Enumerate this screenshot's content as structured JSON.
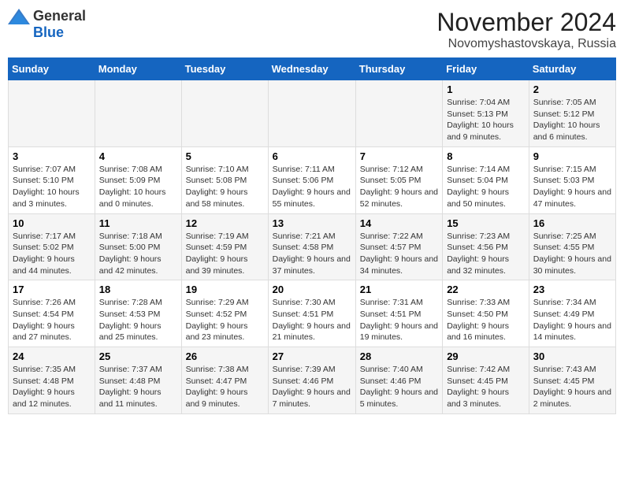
{
  "header": {
    "logo_general": "General",
    "logo_blue": "Blue",
    "month_year": "November 2024",
    "location": "Novomyshastovskaya, Russia"
  },
  "days_of_week": [
    "Sunday",
    "Monday",
    "Tuesday",
    "Wednesday",
    "Thursday",
    "Friday",
    "Saturday"
  ],
  "weeks": [
    [
      {
        "day": "",
        "info": ""
      },
      {
        "day": "",
        "info": ""
      },
      {
        "day": "",
        "info": ""
      },
      {
        "day": "",
        "info": ""
      },
      {
        "day": "",
        "info": ""
      },
      {
        "day": "1",
        "info": "Sunrise: 7:04 AM\nSunset: 5:13 PM\nDaylight: 10 hours and 9 minutes."
      },
      {
        "day": "2",
        "info": "Sunrise: 7:05 AM\nSunset: 5:12 PM\nDaylight: 10 hours and 6 minutes."
      }
    ],
    [
      {
        "day": "3",
        "info": "Sunrise: 7:07 AM\nSunset: 5:10 PM\nDaylight: 10 hours and 3 minutes."
      },
      {
        "day": "4",
        "info": "Sunrise: 7:08 AM\nSunset: 5:09 PM\nDaylight: 10 hours and 0 minutes."
      },
      {
        "day": "5",
        "info": "Sunrise: 7:10 AM\nSunset: 5:08 PM\nDaylight: 9 hours and 58 minutes."
      },
      {
        "day": "6",
        "info": "Sunrise: 7:11 AM\nSunset: 5:06 PM\nDaylight: 9 hours and 55 minutes."
      },
      {
        "day": "7",
        "info": "Sunrise: 7:12 AM\nSunset: 5:05 PM\nDaylight: 9 hours and 52 minutes."
      },
      {
        "day": "8",
        "info": "Sunrise: 7:14 AM\nSunset: 5:04 PM\nDaylight: 9 hours and 50 minutes."
      },
      {
        "day": "9",
        "info": "Sunrise: 7:15 AM\nSunset: 5:03 PM\nDaylight: 9 hours and 47 minutes."
      }
    ],
    [
      {
        "day": "10",
        "info": "Sunrise: 7:17 AM\nSunset: 5:02 PM\nDaylight: 9 hours and 44 minutes."
      },
      {
        "day": "11",
        "info": "Sunrise: 7:18 AM\nSunset: 5:00 PM\nDaylight: 9 hours and 42 minutes."
      },
      {
        "day": "12",
        "info": "Sunrise: 7:19 AM\nSunset: 4:59 PM\nDaylight: 9 hours and 39 minutes."
      },
      {
        "day": "13",
        "info": "Sunrise: 7:21 AM\nSunset: 4:58 PM\nDaylight: 9 hours and 37 minutes."
      },
      {
        "day": "14",
        "info": "Sunrise: 7:22 AM\nSunset: 4:57 PM\nDaylight: 9 hours and 34 minutes."
      },
      {
        "day": "15",
        "info": "Sunrise: 7:23 AM\nSunset: 4:56 PM\nDaylight: 9 hours and 32 minutes."
      },
      {
        "day": "16",
        "info": "Sunrise: 7:25 AM\nSunset: 4:55 PM\nDaylight: 9 hours and 30 minutes."
      }
    ],
    [
      {
        "day": "17",
        "info": "Sunrise: 7:26 AM\nSunset: 4:54 PM\nDaylight: 9 hours and 27 minutes."
      },
      {
        "day": "18",
        "info": "Sunrise: 7:28 AM\nSunset: 4:53 PM\nDaylight: 9 hours and 25 minutes."
      },
      {
        "day": "19",
        "info": "Sunrise: 7:29 AM\nSunset: 4:52 PM\nDaylight: 9 hours and 23 minutes."
      },
      {
        "day": "20",
        "info": "Sunrise: 7:30 AM\nSunset: 4:51 PM\nDaylight: 9 hours and 21 minutes."
      },
      {
        "day": "21",
        "info": "Sunrise: 7:31 AM\nSunset: 4:51 PM\nDaylight: 9 hours and 19 minutes."
      },
      {
        "day": "22",
        "info": "Sunrise: 7:33 AM\nSunset: 4:50 PM\nDaylight: 9 hours and 16 minutes."
      },
      {
        "day": "23",
        "info": "Sunrise: 7:34 AM\nSunset: 4:49 PM\nDaylight: 9 hours and 14 minutes."
      }
    ],
    [
      {
        "day": "24",
        "info": "Sunrise: 7:35 AM\nSunset: 4:48 PM\nDaylight: 9 hours and 12 minutes."
      },
      {
        "day": "25",
        "info": "Sunrise: 7:37 AM\nSunset: 4:48 PM\nDaylight: 9 hours and 11 minutes."
      },
      {
        "day": "26",
        "info": "Sunrise: 7:38 AM\nSunset: 4:47 PM\nDaylight: 9 hours and 9 minutes."
      },
      {
        "day": "27",
        "info": "Sunrise: 7:39 AM\nSunset: 4:46 PM\nDaylight: 9 hours and 7 minutes."
      },
      {
        "day": "28",
        "info": "Sunrise: 7:40 AM\nSunset: 4:46 PM\nDaylight: 9 hours and 5 minutes."
      },
      {
        "day": "29",
        "info": "Sunrise: 7:42 AM\nSunset: 4:45 PM\nDaylight: 9 hours and 3 minutes."
      },
      {
        "day": "30",
        "info": "Sunrise: 7:43 AM\nSunset: 4:45 PM\nDaylight: 9 hours and 2 minutes."
      }
    ]
  ]
}
